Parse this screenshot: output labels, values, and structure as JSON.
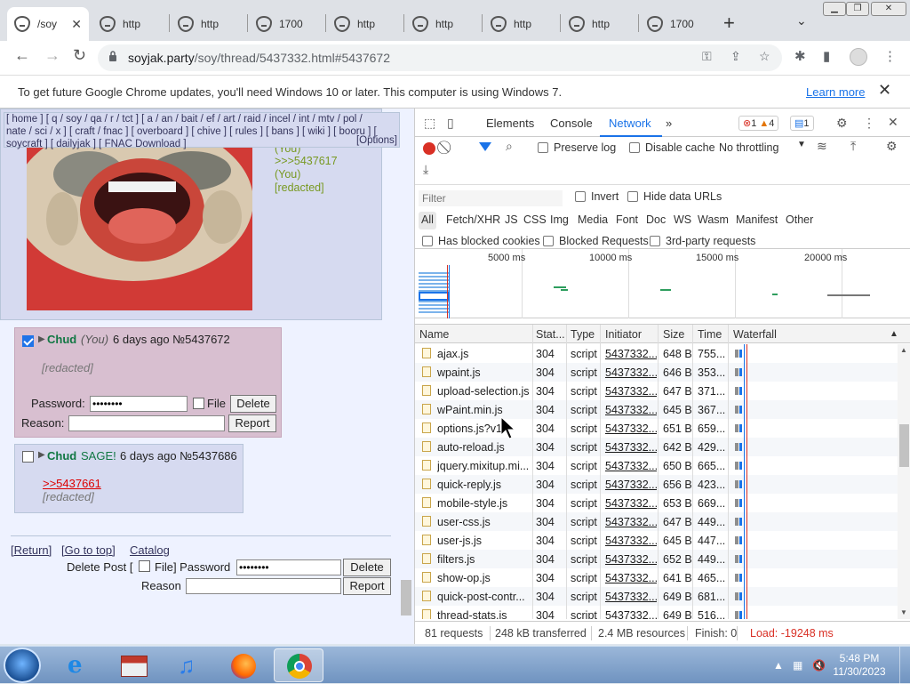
{
  "browser": {
    "tabs": [
      {
        "label": "/soy",
        "active": true
      },
      {
        "label": "http",
        "active": false
      },
      {
        "label": "http",
        "active": false
      },
      {
        "label": "1700",
        "active": false
      },
      {
        "label": "http",
        "active": false
      },
      {
        "label": "http",
        "active": false
      },
      {
        "label": "http",
        "active": false
      },
      {
        "label": "http",
        "active": false
      },
      {
        "label": "1700",
        "active": false
      }
    ],
    "new_tab_icon": "plus-icon",
    "url_host": "soyjak.party",
    "url_path": "/soy/thread/5437332.html#5437672"
  },
  "infobar": {
    "text": "To get future Google Chrome updates, you'll need Windows 10 or later. This computer is using Windows 7.",
    "link": "Learn more",
    "close": "✕"
  },
  "page": {
    "boardnav": {
      "line1": "[ home ] [ q / soy / qa / r / tct ] [ a / an / bait / ef / art / raid / incel / int / mtv / pol /",
      "line2": "nate / sci / x ] [ craft / fnac ] [ overboard ] [ chive ] [ rules ] [ bans ] [ wiki ] [ booru ] [",
      "line3": "soycraft ] [ dailyjak ] [ FNAC Download ]",
      "options": "[Options]"
    },
    "op_partial": {
      "you_top": "(You)",
      "quote_link": ">>>5437617",
      "you": "(You)",
      "greentext_1": "",
      "greentext_2": "",
      "redacted_note": "[redacted]"
    },
    "post1": {
      "checked": true,
      "arrow": "▶",
      "name": "Chud",
      "you": "(You)",
      "meta": "6 days ago №5437672",
      "body": "",
      "redacted_note": "[redacted]",
      "password_label": "Password:",
      "password_value": "••••••••",
      "file_label": "File",
      "delete": "Delete",
      "reason_label": "Reason:",
      "report": "Report"
    },
    "post2": {
      "checked": false,
      "arrow": "▶",
      "name": "Chud",
      "sage": "SAGE!",
      "meta": "6 days ago №5437686",
      "quote_link": ">>5437661",
      "body": "",
      "redacted_note": "[redacted]"
    },
    "footer": {
      "return": "[Return]",
      "top": "[Go to top]",
      "catalog": "Catalog",
      "delete_post": "Delete Post [",
      "file": "File] Password",
      "password_value": "••••••••",
      "delete": "Delete",
      "reason": "Reason",
      "report": "Report"
    }
  },
  "devtools": {
    "tabs": [
      "Elements",
      "Console",
      "Network"
    ],
    "active_tab": "Network",
    "more": "»",
    "errors": "1",
    "warnings": "4",
    "messages": "1",
    "preserve_log": "Preserve log",
    "disable_cache": "Disable cache",
    "throttling": "No throttling",
    "filter_placeholder": "Filter",
    "invert": "Invert",
    "hide_data_urls": "Hide data URLs",
    "types": [
      "All",
      "Fetch/XHR",
      "JS",
      "CSS",
      "Img",
      "Media",
      "Font",
      "Doc",
      "WS",
      "Wasm",
      "Manifest",
      "Other"
    ],
    "has_blocked_cookies": "Has blocked cookies",
    "blocked_requests": "Blocked Requests",
    "third_party": "3rd-party requests",
    "overview_ticks": [
      "5000 ms",
      "10000 ms",
      "15000 ms",
      "20000 ms"
    ],
    "columns": [
      "Name",
      "Stat...",
      "Type",
      "Initiator",
      "Size",
      "Time",
      "Waterfall"
    ],
    "rows": [
      {
        "name": "ajax.js",
        "status": "304",
        "type": "script",
        "initiator": "5437332...",
        "size": "648 B",
        "time": "755..."
      },
      {
        "name": "wpaint.js",
        "status": "304",
        "type": "script",
        "initiator": "5437332...",
        "size": "646 B",
        "time": "353..."
      },
      {
        "name": "upload-selection.js",
        "status": "304",
        "type": "script",
        "initiator": "5437332...",
        "size": "647 B",
        "time": "371..."
      },
      {
        "name": "wPaint.min.js",
        "status": "304",
        "type": "script",
        "initiator": "5437332...",
        "size": "645 B",
        "time": "367..."
      },
      {
        "name": "options.js?v1",
        "status": "304",
        "type": "script",
        "initiator": "5437332...",
        "size": "651 B",
        "time": "659..."
      },
      {
        "name": "auto-reload.js",
        "status": "304",
        "type": "script",
        "initiator": "5437332...",
        "size": "642 B",
        "time": "429..."
      },
      {
        "name": "jquery.mixitup.mi...",
        "status": "304",
        "type": "script",
        "initiator": "5437332...",
        "size": "650 B",
        "time": "665..."
      },
      {
        "name": "quick-reply.js",
        "status": "304",
        "type": "script",
        "initiator": "5437332...",
        "size": "656 B",
        "time": "423..."
      },
      {
        "name": "mobile-style.js",
        "status": "304",
        "type": "script",
        "initiator": "5437332...",
        "size": "653 B",
        "time": "669..."
      },
      {
        "name": "user-css.js",
        "status": "304",
        "type": "script",
        "initiator": "5437332...",
        "size": "647 B",
        "time": "449..."
      },
      {
        "name": "user-js.js",
        "status": "304",
        "type": "script",
        "initiator": "5437332...",
        "size": "645 B",
        "time": "447..."
      },
      {
        "name": "filters.js",
        "status": "304",
        "type": "script",
        "initiator": "5437332...",
        "size": "652 B",
        "time": "449..."
      },
      {
        "name": "show-op.js",
        "status": "304",
        "type": "script",
        "initiator": "5437332...",
        "size": "641 B",
        "time": "465..."
      },
      {
        "name": "quick-post-contr...",
        "status": "304",
        "type": "script",
        "initiator": "5437332...",
        "size": "649 B",
        "time": "681..."
      },
      {
        "name": "thread-stats.js",
        "status": "304",
        "type": "script",
        "initiator": "5437332...",
        "size": "649 B",
        "time": "516..."
      }
    ],
    "status_bar": {
      "requests": "81 requests",
      "transferred": "248 kB transferred",
      "resources": "2.4 MB resources",
      "finish": "Finish: 0",
      "load": "Load: -19248 ms"
    }
  },
  "taskbar": {
    "time": "5:48 PM",
    "date": "11/30/2023"
  },
  "colors": {
    "accent": "#1a73e8",
    "error": "#d93025",
    "greentext": "#789922",
    "poster_name": "#117743"
  }
}
